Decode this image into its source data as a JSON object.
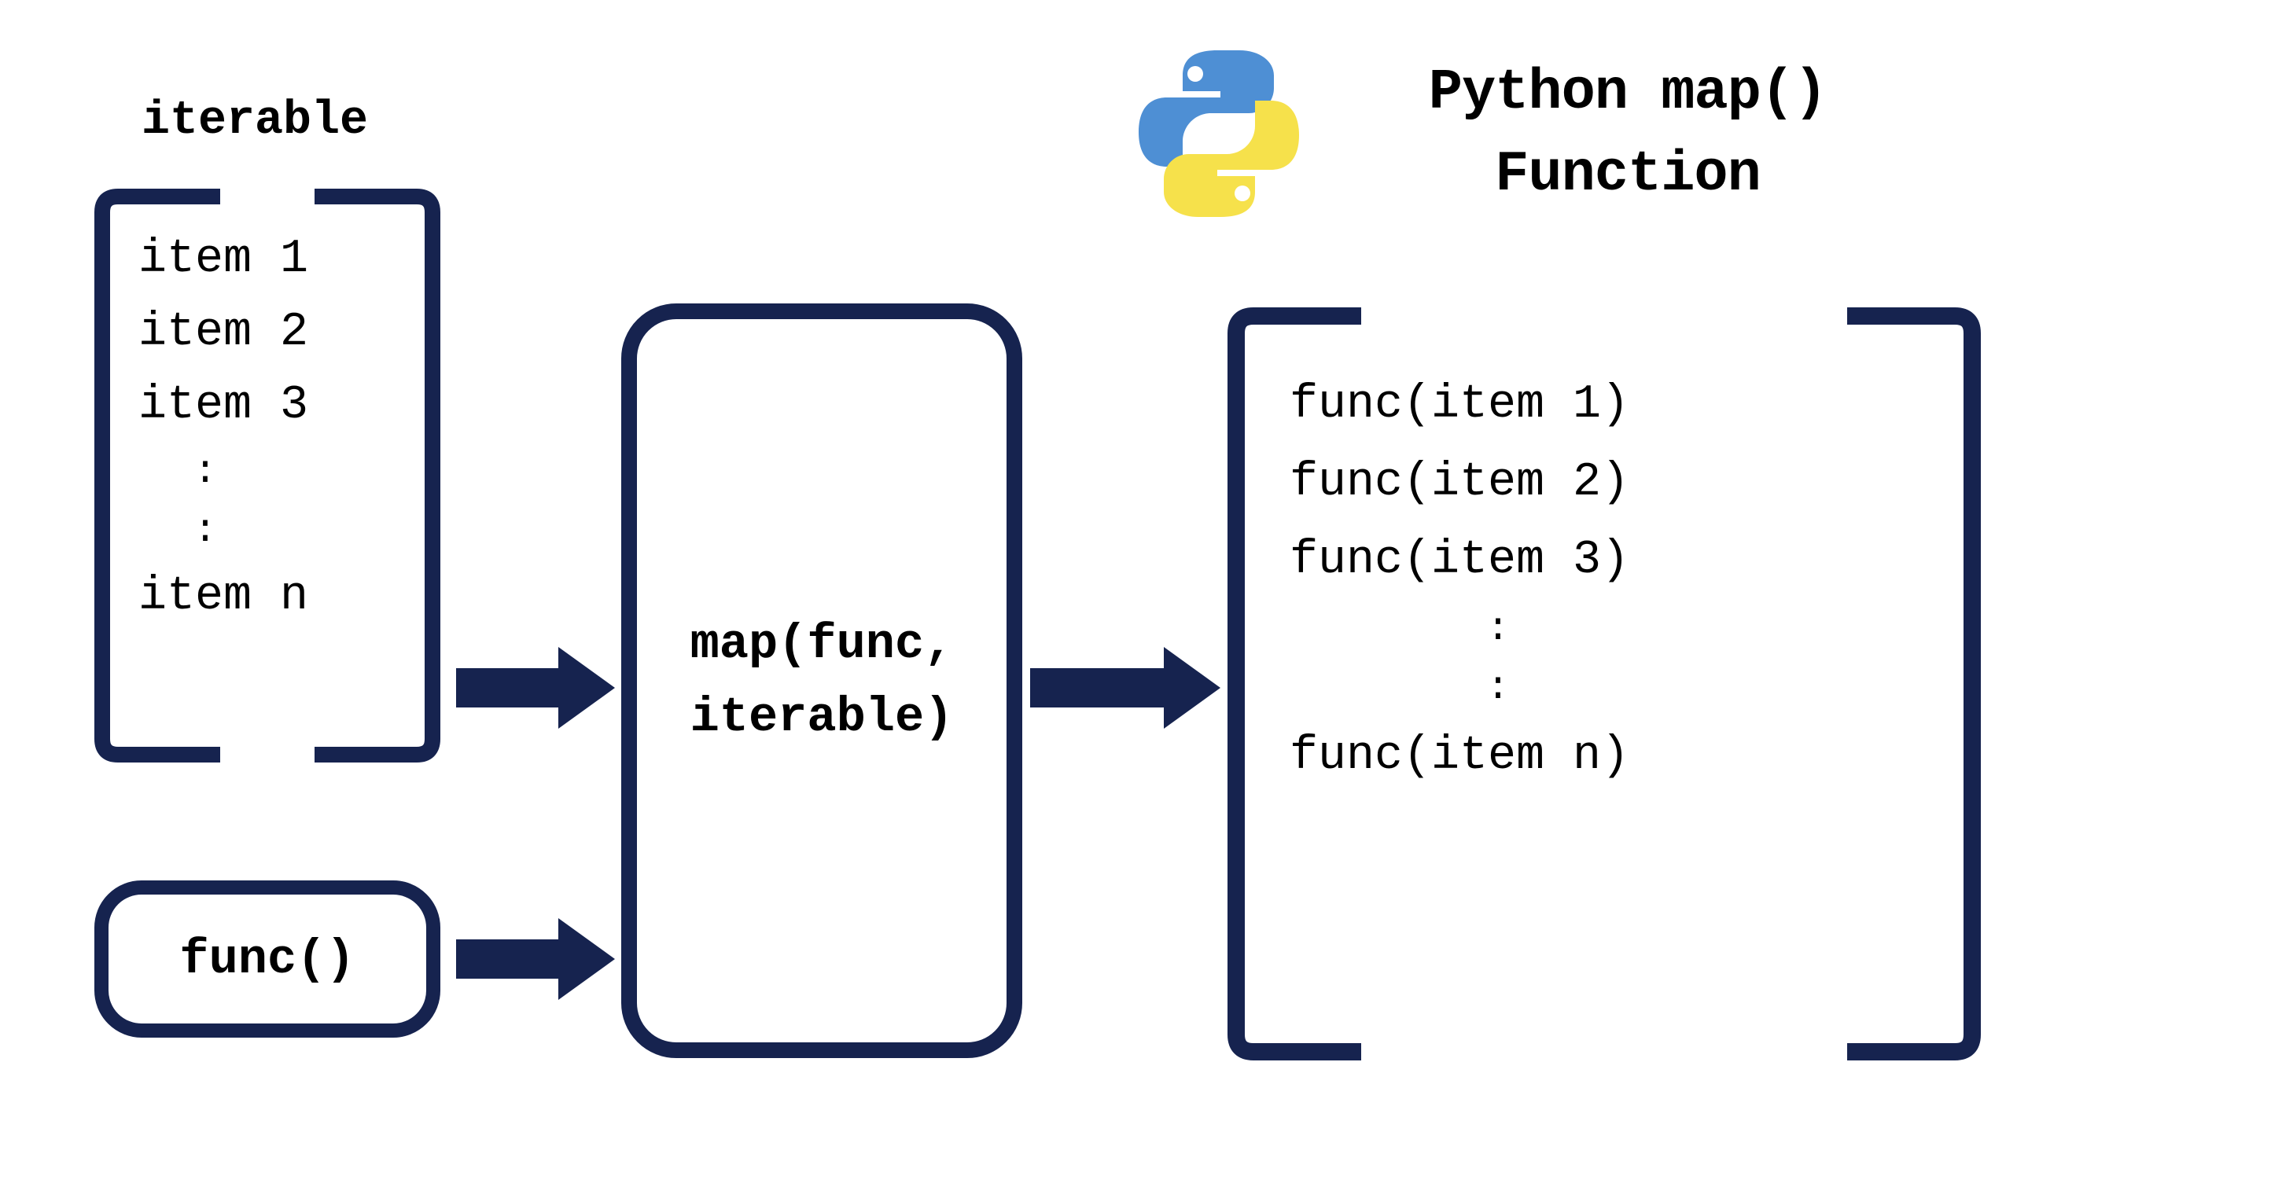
{
  "title": {
    "line1": "Python map()",
    "line2": "Function"
  },
  "iterable": {
    "label": "iterable",
    "items": [
      "item 1",
      "item 2",
      "item 3"
    ],
    "last": "item n"
  },
  "func": {
    "label": "func()"
  },
  "map_box": {
    "line1": "map(func,",
    "line2": "iterable)"
  },
  "output": {
    "items": [
      "func(item 1)",
      "func(item 2)",
      "func(item 3)"
    ],
    "last": "func(item n)"
  },
  "colors": {
    "navy": "#16234f",
    "python_blue": "#4e8fd4",
    "python_yellow": "#f6e14b"
  }
}
